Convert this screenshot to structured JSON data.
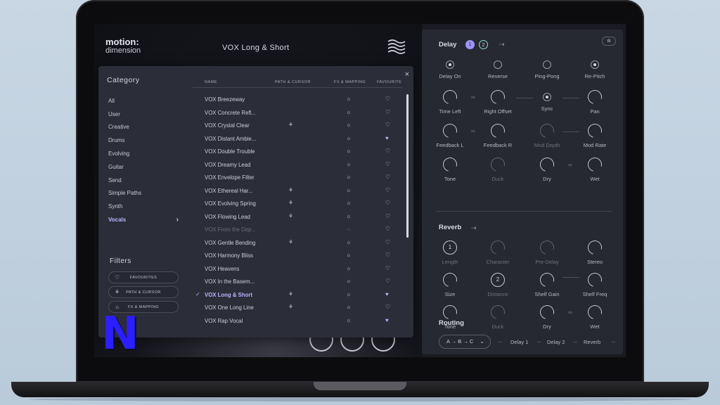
{
  "app": {
    "logo_line1": "motion:",
    "logo_line2": "dimension",
    "preset_title": "VOX Long & Short"
  },
  "browser": {
    "close": "×",
    "category_title": "Category",
    "categories": [
      {
        "label": "All"
      },
      {
        "label": "User"
      },
      {
        "label": "Creative"
      },
      {
        "label": "Drums"
      },
      {
        "label": "Evolving"
      },
      {
        "label": "Guitar"
      },
      {
        "label": "Send"
      },
      {
        "label": "Simple Paths"
      },
      {
        "label": "Synth"
      },
      {
        "label": "Vocals",
        "active": true,
        "chevron": "›"
      }
    ],
    "filters_title": "Filters",
    "filters": [
      {
        "label": "FAVOURITES",
        "icon": "heart-icon",
        "glyph": "♡"
      },
      {
        "label": "PATH & CURSOR",
        "icon": "path-icon",
        "glyph": "⚘"
      },
      {
        "label": "FX & MAPPING",
        "icon": "fx-icon",
        "glyph": "☼"
      }
    ],
    "columns": {
      "name": "NAME",
      "path": "PATH & CURSOR",
      "fx": "FX & MAPPING",
      "fav": "FAVOURITE"
    },
    "selected_check": "✓",
    "rows": [
      {
        "name": "VOX Breezeway",
        "path": false,
        "fx": true,
        "fav": false
      },
      {
        "name": "VOX Concrete Refl...",
        "path": false,
        "fx": true,
        "fav": false
      },
      {
        "name": "VOX Crystal Clear",
        "path": true,
        "fx": true,
        "fav": false
      },
      {
        "name": "VOX Distant Ambie...",
        "path": false,
        "fx": true,
        "fav": true
      },
      {
        "name": "VOX Double Trouble",
        "path": false,
        "fx": true,
        "fav": false
      },
      {
        "name": "VOX Dreamy Lead",
        "path": false,
        "fx": true,
        "fav": false
      },
      {
        "name": "VOX Envelope Filter",
        "path": false,
        "fx": true,
        "fav": false
      },
      {
        "name": "VOX Ethereal Har...",
        "path": true,
        "fx": true,
        "fav": false
      },
      {
        "name": "VOX Evolving Spring",
        "path": true,
        "fx": true,
        "fav": false
      },
      {
        "name": "VOX Flowing Lead",
        "path": true,
        "fx": true,
        "fav": false
      },
      {
        "name": "VOX From the Dep...",
        "path": false,
        "fx": true,
        "fav": false,
        "dim": true
      },
      {
        "name": "VOX Gentle Bending",
        "path": true,
        "fx": true,
        "fav": false
      },
      {
        "name": "VOX Harmony Bliss",
        "path": false,
        "fx": true,
        "fav": false
      },
      {
        "name": "VOX Heavens",
        "path": false,
        "fx": true,
        "fav": false
      },
      {
        "name": "VOX In the Basem...",
        "path": false,
        "fx": true,
        "fav": false
      },
      {
        "name": "VOX Long & Short",
        "path": true,
        "fx": true,
        "fav": true,
        "selected": true
      },
      {
        "name": "VOX One Long Line",
        "path": true,
        "fx": true,
        "fav": false
      },
      {
        "name": "VOX Rap Vocal",
        "path": false,
        "fx": true,
        "fav": true
      }
    ]
  },
  "delay": {
    "title": "Delay",
    "badge1": "1",
    "badge2": "2",
    "arrow": "⇢",
    "chart_button": "ılı",
    "row1": [
      {
        "label": "Delay On",
        "type": "radio",
        "on": true
      },
      {
        "label": "Reverse",
        "type": "radio",
        "on": false
      },
      {
        "label": "Ping-Pong",
        "type": "radio",
        "on": false
      },
      {
        "label": "Re-Pitch",
        "type": "radio",
        "on": true
      }
    ],
    "row2": [
      {
        "label": "Time Left",
        "type": "knob"
      },
      {
        "label": "Right Offset",
        "type": "knob"
      },
      {
        "label": "Sync",
        "type": "radio",
        "on": true
      },
      {
        "label": "Pan",
        "type": "knob"
      }
    ],
    "row3": [
      {
        "label": "Feedback L",
        "type": "knob"
      },
      {
        "label": "Feedback R",
        "type": "knob"
      },
      {
        "label": "Mod Depth",
        "type": "knob",
        "dim": true
      },
      {
        "label": "Mod Rate",
        "type": "knob"
      }
    ],
    "row4": [
      {
        "label": "Tone",
        "type": "knob"
      },
      {
        "label": "Duck",
        "type": "knob",
        "dim": true
      },
      {
        "label": "Dry",
        "type": "knob"
      },
      {
        "label": "Wet",
        "type": "knob"
      }
    ],
    "link_glyph": "∞"
  },
  "reverb": {
    "title": "Reverb",
    "arrow": "⇢",
    "row1": [
      {
        "label": "Length",
        "type": "knobnum",
        "value": "1",
        "dimlabel": true
      },
      {
        "label": "Character",
        "type": "knob",
        "dim": true
      },
      {
        "label": "Pre-Delay",
        "type": "knob",
        "dim": true
      },
      {
        "label": "Stereo",
        "type": "knob"
      }
    ],
    "row2": [
      {
        "label": "Size",
        "type": "knob"
      },
      {
        "label": "Distance",
        "type": "knobnum",
        "value": "2",
        "dimlabel": true
      },
      {
        "label": "Shelf Gain",
        "type": "knob"
      },
      {
        "label": "Shelf Freq",
        "type": "knob"
      }
    ],
    "row3": [
      {
        "label": "Tone",
        "type": "knob"
      },
      {
        "label": "Duck",
        "type": "knob",
        "dim": true
      },
      {
        "label": "Dry",
        "type": "knob"
      },
      {
        "label": "Wet",
        "type": "knob"
      }
    ]
  },
  "routing": {
    "title": "Routing",
    "select_value": "A → B → C",
    "chevron": "⌄",
    "items": [
      "Delay 1",
      "Delay 2",
      "Reverb"
    ],
    "arrow": "→",
    "back_arrow": "←"
  },
  "overlay": {
    "n_logo": "N"
  }
}
